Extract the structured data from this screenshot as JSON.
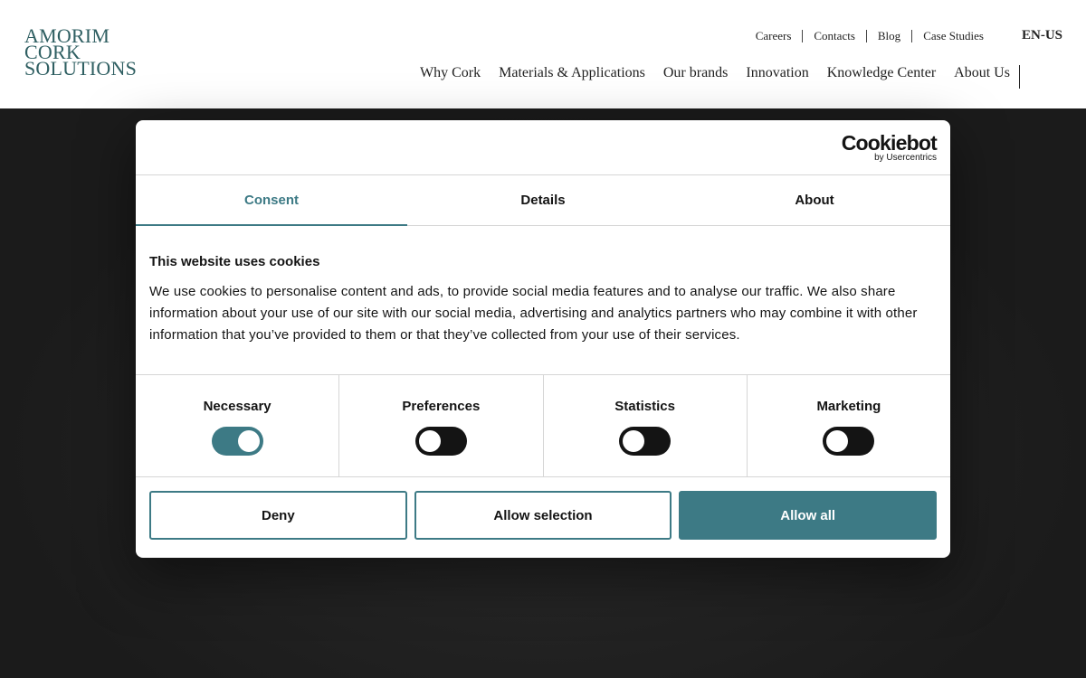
{
  "header": {
    "logo_lines": [
      "AMORIM",
      "CORK",
      "SOLUTIONS"
    ],
    "top_links": [
      "Careers",
      "Contacts",
      "Blog",
      "Case Studies"
    ],
    "language": "EN-US",
    "main_nav": [
      "Why Cork",
      "Materials & Applications",
      "Our brands",
      "Innovation",
      "Knowledge Center",
      "About Us"
    ]
  },
  "dialog": {
    "brand": {
      "name": "Cookiebot",
      "sub": "by Usercentrics"
    },
    "tabs": [
      "Consent",
      "Details",
      "About"
    ],
    "active_tab": "Consent",
    "title": "This website uses cookies",
    "body": "We use cookies to personalise content and ads, to provide social media features and to analyse our traffic. We also share information about your use of our site with our social media, advertising and analytics partners who may combine it with other information that you’ve provided to them or that they’ve collected from your use of their services.",
    "toggles": [
      {
        "label": "Necessary",
        "on": true
      },
      {
        "label": "Preferences",
        "on": false
      },
      {
        "label": "Statistics",
        "on": false
      },
      {
        "label": "Marketing",
        "on": false
      }
    ],
    "buttons": {
      "deny": "Deny",
      "allow_selection": "Allow selection",
      "allow_all": "Allow all"
    },
    "accent_color": "#3d7a85"
  }
}
